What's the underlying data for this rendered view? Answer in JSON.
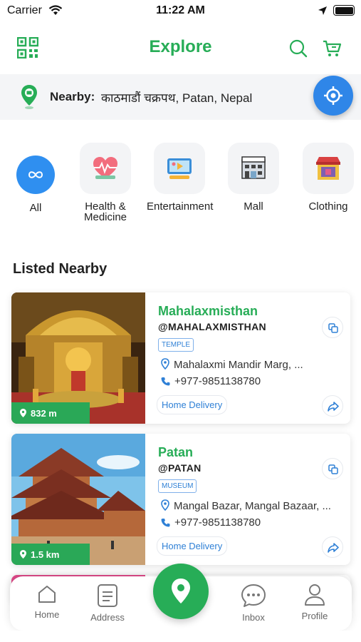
{
  "status_bar": {
    "carrier": "Carrier",
    "time": "11:22 AM"
  },
  "header": {
    "title": "Explore",
    "icons": [
      "qr-code-icon",
      "search-icon",
      "cart-icon"
    ]
  },
  "location": {
    "label": "Nearby:",
    "value": "काठमाडौं चक्रपथ,  Patan, Nepal"
  },
  "categories": [
    {
      "label": "All",
      "icon": "infinity-icon"
    },
    {
      "label": "Health & Medicine",
      "icon": "heart-pulse-icon"
    },
    {
      "label": "Entertainment",
      "icon": "tv-icon"
    },
    {
      "label": "Mall",
      "icon": "mall-icon"
    },
    {
      "label": "Clothing",
      "icon": "shop-icon"
    }
  ],
  "section": {
    "title": "Listed Nearby"
  },
  "listings": [
    {
      "name": "Mahalaxmisthan",
      "handle": "@MAHALAXMISTHAN",
      "tag": "TEMPLE",
      "address": "Mahalaxmi Mandir Marg, ...",
      "phone": "+977-9851138780",
      "delivery": "Home Delivery",
      "distance": "832 m"
    },
    {
      "name": "Patan",
      "handle": "@PATAN",
      "tag": "MUSEUM",
      "address": "Mangal Bazar, Mangal Bazaar, ...",
      "phone": "+977-9851138780",
      "delivery": "Home Delivery",
      "distance": "1.5 km"
    }
  ],
  "bottom_nav": {
    "items": [
      {
        "label": "Home"
      },
      {
        "label": "Address"
      },
      {
        "label": "Inbox"
      },
      {
        "label": "Profile"
      }
    ]
  },
  "colors": {
    "brand_green": "#27ad57",
    "accent_blue": "#2f86e8"
  }
}
